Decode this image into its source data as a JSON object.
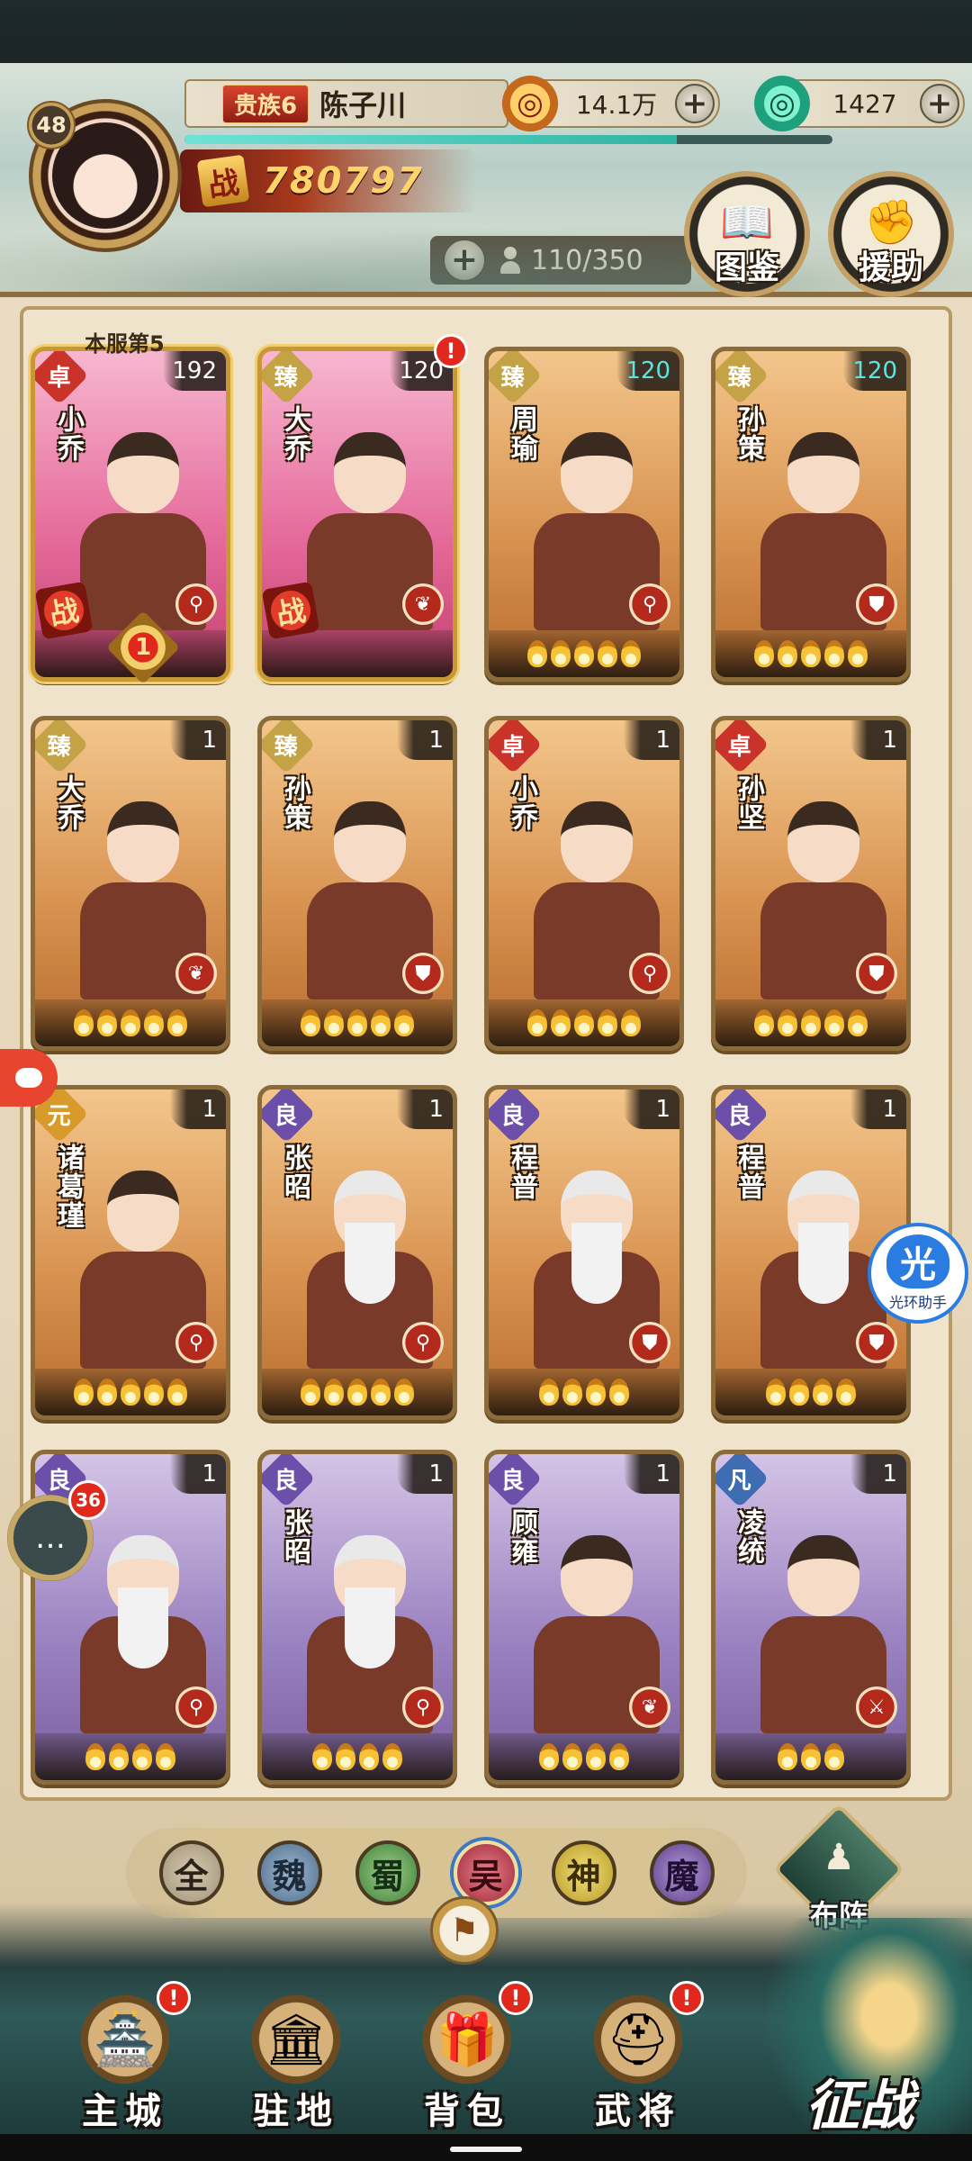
{
  "player": {
    "level": "48",
    "vip": "贵族6",
    "name": "陈子川",
    "exp_fraction": 0.76,
    "power_label": "战",
    "power": "780797"
  },
  "currencies": {
    "gold": {
      "value": "14.1万",
      "icon": "coin-icon"
    },
    "jade": {
      "value": "1427",
      "icon": "jade-icon"
    }
  },
  "roster": {
    "count": "110/350"
  },
  "side_buttons": {
    "codex": "图鉴",
    "assist": "援助"
  },
  "server_rank": "本服第5",
  "heroes": [
    {
      "grade": "卓",
      "grade_class": "zhuo",
      "name": "小乔",
      "level": "192",
      "level_cyan": false,
      "bg": "pink",
      "role": "skill",
      "stars": 0,
      "battle": true,
      "gold": true
    },
    {
      "grade": "臻",
      "grade_class": "zhen",
      "name": "大乔",
      "level": "120",
      "level_cyan": false,
      "bg": "pink",
      "role": "heal",
      "stars": 0,
      "battle": true,
      "gold": true,
      "alert": true
    },
    {
      "grade": "臻",
      "grade_class": "zhen",
      "name": "周瑜",
      "level": "120",
      "level_cyan": true,
      "bg": "orange",
      "role": "skill",
      "stars": 5
    },
    {
      "grade": "臻",
      "grade_class": "zhen",
      "name": "孙策",
      "level": "120",
      "level_cyan": true,
      "bg": "orange",
      "role": "shield",
      "stars": 5
    },
    {
      "grade": "臻",
      "grade_class": "zhen",
      "name": "大乔",
      "level": "1",
      "bg": "orange",
      "role": "heal",
      "stars": 5
    },
    {
      "grade": "臻",
      "grade_class": "zhen",
      "name": "孙策",
      "level": "1",
      "bg": "orange",
      "role": "shield",
      "stars": 5
    },
    {
      "grade": "卓",
      "grade_class": "zhuo",
      "name": "小乔",
      "level": "1",
      "bg": "orange",
      "role": "skill",
      "stars": 5
    },
    {
      "grade": "卓",
      "grade_class": "zhuo",
      "name": "孙坚",
      "level": "1",
      "bg": "orange",
      "role": "shield",
      "stars": 5
    },
    {
      "grade": "元",
      "grade_class": "yuan",
      "name": "诸葛瑾",
      "level": "1",
      "bg": "orange",
      "role": "skill",
      "stars": 5
    },
    {
      "grade": "良",
      "grade_class": "liang",
      "name": "张昭",
      "level": "1",
      "bg": "orange",
      "role": "skill",
      "stars": 5,
      "white": true
    },
    {
      "grade": "良",
      "grade_class": "liang",
      "name": "程普",
      "level": "1",
      "bg": "orange",
      "role": "shield",
      "stars": 4,
      "white": true
    },
    {
      "grade": "良",
      "grade_class": "liang",
      "name": "程普",
      "level": "1",
      "bg": "orange",
      "role": "shield",
      "stars": 4,
      "white": true
    },
    {
      "grade": "良",
      "grade_class": "liang",
      "name": "",
      "level": "1",
      "bg": "purple",
      "role": "skill",
      "stars": 4,
      "white": true
    },
    {
      "grade": "良",
      "grade_class": "liang",
      "name": "张昭",
      "level": "1",
      "bg": "purple",
      "role": "skill",
      "stars": 4,
      "white": true
    },
    {
      "grade": "良",
      "grade_class": "liang",
      "name": "顾雍",
      "level": "1",
      "bg": "purple",
      "role": "heal",
      "stars": 4
    },
    {
      "grade": "凡",
      "grade_class": "fan",
      "name": "凌统",
      "level": "1",
      "bg": "purple",
      "role": "attack",
      "stars": 3
    }
  ],
  "battle_tag": "战",
  "medal_text": "1",
  "filters": [
    {
      "label": "全",
      "cls": "f-all",
      "name": "filter-all"
    },
    {
      "label": "魏",
      "cls": "f-wei",
      "name": "filter-wei"
    },
    {
      "label": "蜀",
      "cls": "f-shu",
      "name": "filter-shu"
    },
    {
      "label": "吴",
      "cls": "f-wu",
      "name": "filter-wu"
    },
    {
      "label": "神",
      "cls": "f-shen",
      "name": "filter-shen"
    },
    {
      "label": "魔",
      "cls": "f-mo",
      "name": "filter-mo"
    }
  ],
  "active_filter": "吴",
  "formation": "布阵",
  "nav": [
    {
      "label": "主城",
      "icon": "castle-icon",
      "glyph": "🏯",
      "alert": true
    },
    {
      "label": "驻地",
      "icon": "camp-icon",
      "glyph": "🏛",
      "alert": false
    },
    {
      "label": "背包",
      "icon": "bag-icon",
      "glyph": "🎁",
      "alert": true
    },
    {
      "label": "武将",
      "icon": "helmet-icon",
      "glyph": "⛑",
      "alert": true
    }
  ],
  "campaign": "征战",
  "assistant": {
    "glyph": "光",
    "label": "光环助手"
  },
  "chat_count": "36",
  "colors": {
    "accent_cyan": "#59e6e0",
    "alert_red": "#e0281c",
    "frame_gold": "#8b6b3a"
  }
}
